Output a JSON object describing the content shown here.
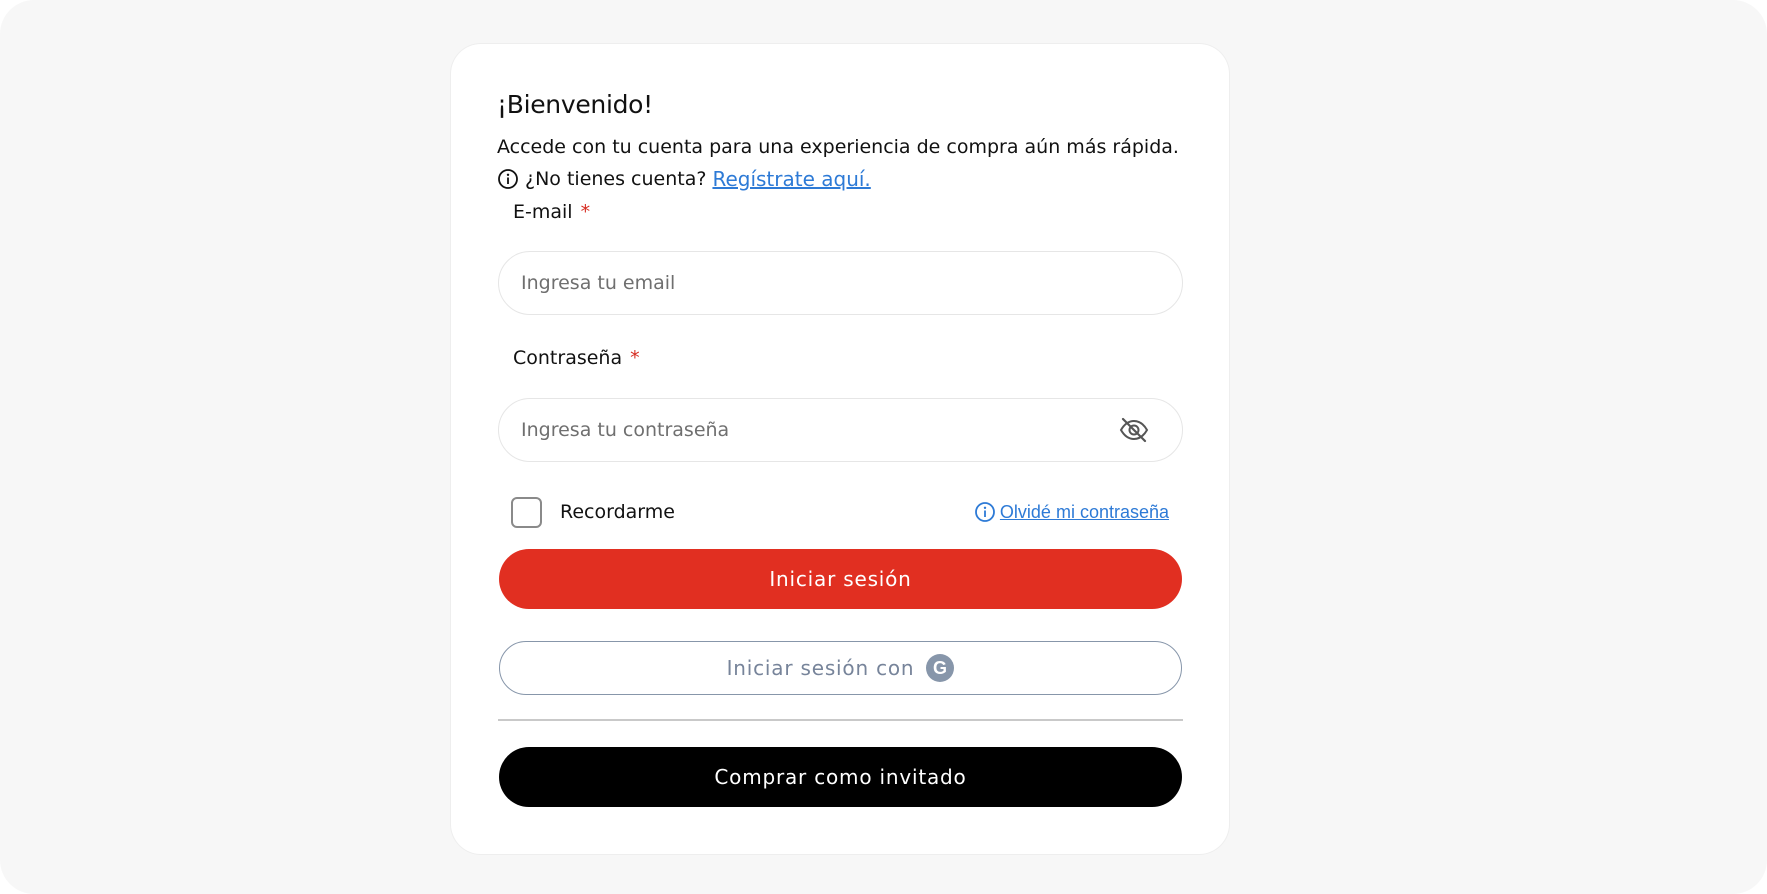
{
  "login": {
    "title": "¡Bienvenido!",
    "subtitle": "Accede con tu cuenta para una experiencia de compra aún más rápida.",
    "no_account_text": "¿No tienes cuenta?",
    "register_link": "Regístrate aquí.",
    "email": {
      "label": "E-mail",
      "required_mark": "*",
      "placeholder": "Ingresa tu email",
      "value": ""
    },
    "password": {
      "label": "Contraseña",
      "required_mark": "*",
      "placeholder": "Ingresa tu contraseña",
      "value": ""
    },
    "remember_label": "Recordarme",
    "remember_checked": false,
    "forgot_link": "Olvidé mi contraseña",
    "primary_button": "Iniciar sesión",
    "google_button": "Iniciar sesión con",
    "guest_button": "Comprar como invitado"
  },
  "icons": {
    "info": "info-icon",
    "eye": "eye-off-icon",
    "google": "google-icon"
  },
  "colors": {
    "primary": "#e12f21",
    "link": "#2d7ad6",
    "guest": "#000000",
    "google_outline": "#8796aa",
    "required": "#d62b20"
  }
}
